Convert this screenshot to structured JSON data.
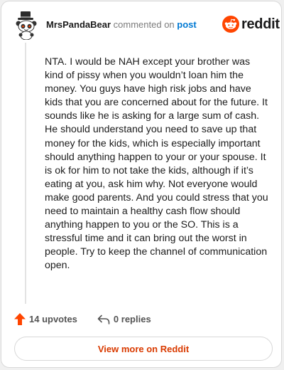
{
  "header": {
    "username": "MrsPandaBear",
    "action_text": "commented on",
    "post_link": "post"
  },
  "logo": {
    "wordmark": "reddit",
    "icon": "reddit-snoo-icon"
  },
  "comment": {
    "body": "NTA. I would be NAH except your brother was kind of pissy when you wouldn’t loan him the money. You guys have high risk jobs and have kids that you are concerned about for the future. It sounds like he is asking for a large sum of cash. He should understand you need to save up that money for the kids, which is especially important should anything happen to your or your spouse. It is ok for him to not take the kids, although if it’s eating at you, ask him why. Not everyone would make good parents. And you could stress that you need to maintain a healthy cash flow should anything happen to you or the SO. This is a stressful time and it can bring out the worst in people. Try to keep the channel of communication open."
  },
  "actions": {
    "upvotes": "14 upvotes",
    "replies": "0 replies"
  },
  "footer": {
    "view_more": "View more on Reddit"
  },
  "colors": {
    "brand": "#ff4500",
    "link": "#0079d3",
    "view_more": "#d93a00"
  }
}
